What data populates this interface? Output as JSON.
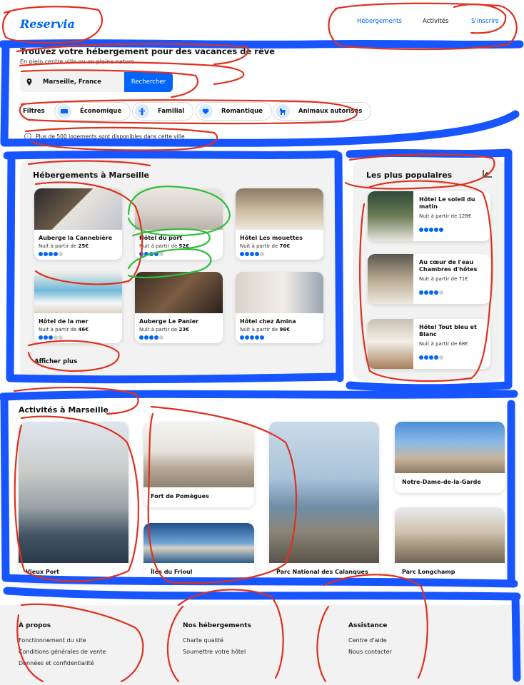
{
  "header": {
    "logo": "Reservia",
    "nav": [
      "Hébergements",
      "Activités",
      "S'inscrire"
    ]
  },
  "hero": {
    "title": "Trouvez votre hébergement pour des vacances de rêve",
    "subtitle": "En plein centre ville ou en pleine nature",
    "search_value": "Marseille, France",
    "search_button": "Rechercher",
    "filters_label": "Filtres",
    "filters": [
      "Économique",
      "Familial",
      "Romantique",
      "Animaux autorisés"
    ],
    "info": "Plus de 500 logements sont disponibles dans cette ville"
  },
  "hotels": {
    "title": "Hébergements à Marseille",
    "price_prefix": "Nuit à partir de",
    "items": [
      {
        "name": "Auberge la Cannebière",
        "price": "25€",
        "stars": 4
      },
      {
        "name": "Hôtel du port",
        "price": "52€",
        "stars": 4
      },
      {
        "name": "Hôtel Les mouettes",
        "price": "76€",
        "stars": 4
      },
      {
        "name": "Hôtel de la mer",
        "price": "46€",
        "stars": 3
      },
      {
        "name": "Auberge Le Panier",
        "price": "23€",
        "stars": 4
      },
      {
        "name": "Hôtel chez Amina",
        "price": "96€",
        "stars": 5
      }
    ],
    "more": "Afficher plus"
  },
  "popular": {
    "title": "Les plus populaires",
    "items": [
      {
        "name": "Hôtel Le soleil du matin",
        "price": "Nuit à partir de 128€",
        "stars": 5
      },
      {
        "name": "Au cœur de l'eau Chambres d'hôtes",
        "price": "Nuit à partir de 71€",
        "stars": 4
      },
      {
        "name": "Hôtel Tout bleu et Blanc",
        "price": "Nuit à partir de 68€",
        "stars": 4
      }
    ]
  },
  "activities": {
    "title": "Activités à Marseille",
    "items": [
      "Vieux Port",
      "Fort de Pomègues",
      "Îles du Frioul",
      "Parc National des Calanques",
      "Notre-Dame-de-la-Garde",
      "Parc Longchamp"
    ]
  },
  "footer": {
    "columns": [
      {
        "title": "À propos",
        "links": [
          "Fonctionnement du site",
          "Conditions générales de vente",
          "Données et confidentialité"
        ]
      },
      {
        "title": "Nos hébergements",
        "links": [
          "Charte qualité",
          "Soumettre votre hôtel"
        ]
      },
      {
        "title": "Assistance",
        "links": [
          "Centre d'aide",
          "Nous contacter"
        ]
      }
    ]
  },
  "colors": {
    "accent": "#0065fc",
    "annotation_red": "#e0301e",
    "annotation_blue": "#0a4cff",
    "annotation_green": "#2ebd3a"
  }
}
